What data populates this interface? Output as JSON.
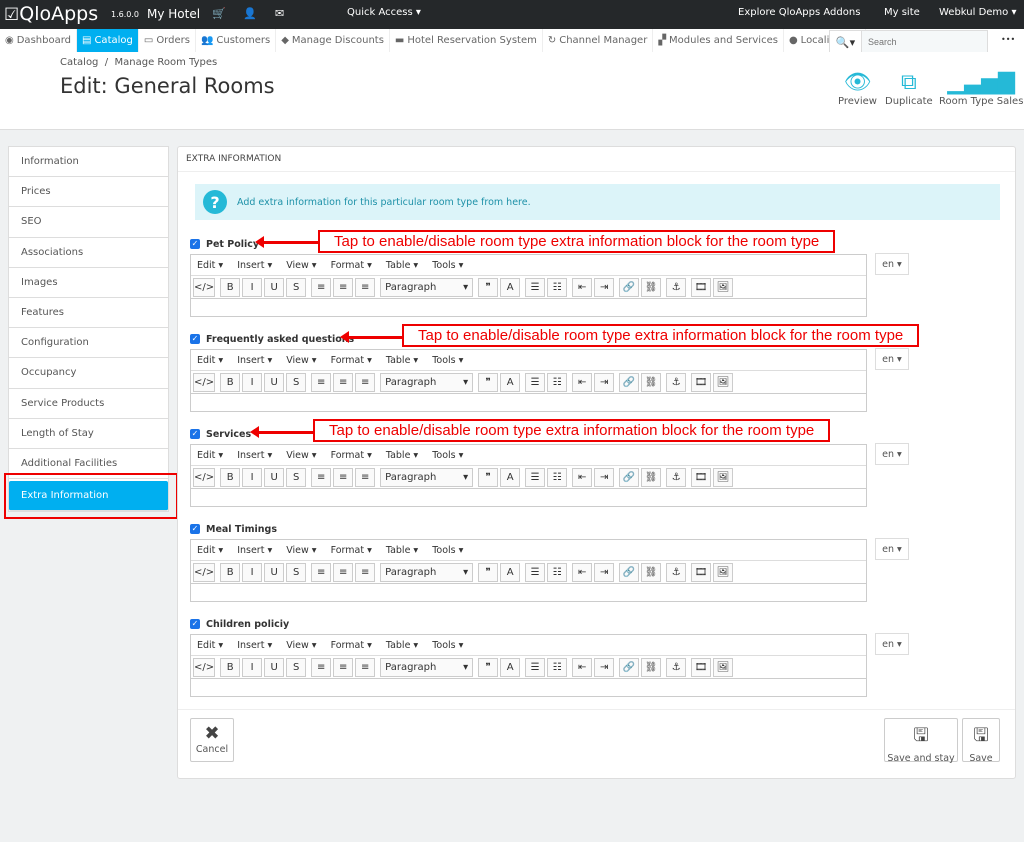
{
  "topbar": {
    "brand": "QloApps",
    "version": "1.6.0.0",
    "shop": "My Hotel",
    "quick_access": "Quick Access ▾",
    "addons": "Explore QloApps Addons",
    "my_site": "My site",
    "user": "Webkul Demo ▾"
  },
  "nav": [
    {
      "label": "Dashboard",
      "icon": "◉"
    },
    {
      "label": "Catalog",
      "icon": "▤",
      "active": true
    },
    {
      "label": "Orders",
      "icon": "▭"
    },
    {
      "label": "Customers",
      "icon": "👥"
    },
    {
      "label": "Manage Discounts",
      "icon": "◆"
    },
    {
      "label": "Hotel Reservation System",
      "icon": "▬"
    },
    {
      "label": "Channel Manager",
      "icon": "↻"
    },
    {
      "label": "Modules and Services",
      "icon": "▞"
    },
    {
      "label": "Localization",
      "icon": "●"
    }
  ],
  "search": {
    "placeholder": "Search",
    "more": "•••"
  },
  "breadcrumb": {
    "root": "Catalog",
    "sep": "/",
    "current": "Manage Room Types"
  },
  "page_title": "Edit: General Rooms",
  "actions": {
    "preview": "Preview",
    "duplicate": "Duplicate",
    "sales": "Room Type Sales"
  },
  "sidebar": [
    "Information",
    "Prices",
    "SEO",
    "Associations",
    "Images",
    "Features",
    "Configuration",
    "Occupancy",
    "Service Products",
    "Length of Stay",
    "Additional Facilities",
    "Extra Information"
  ],
  "sidebar_active": "Extra Information",
  "panel": {
    "title": "Extra information",
    "info": "Add extra information for this particular room type from here."
  },
  "editor": {
    "menus": [
      "Edit ▾",
      "Insert ▾",
      "View ▾",
      "Format ▾",
      "Table ▾",
      "Tools ▾"
    ],
    "format": "Paragraph",
    "lang": "en ▾"
  },
  "blocks": [
    {
      "label": "Pet Policy",
      "checked": true
    },
    {
      "label": "Frequently asked questions",
      "checked": true
    },
    {
      "label": "Services",
      "checked": true
    },
    {
      "label": "Meal Timings",
      "checked": true
    },
    {
      "label": "Children policiy",
      "checked": true
    }
  ],
  "annotation": "Tap to enable/disable room type extra information block for the room type",
  "footer": {
    "cancel": "Cancel",
    "save_stay": "Save and stay",
    "save": "Save"
  }
}
